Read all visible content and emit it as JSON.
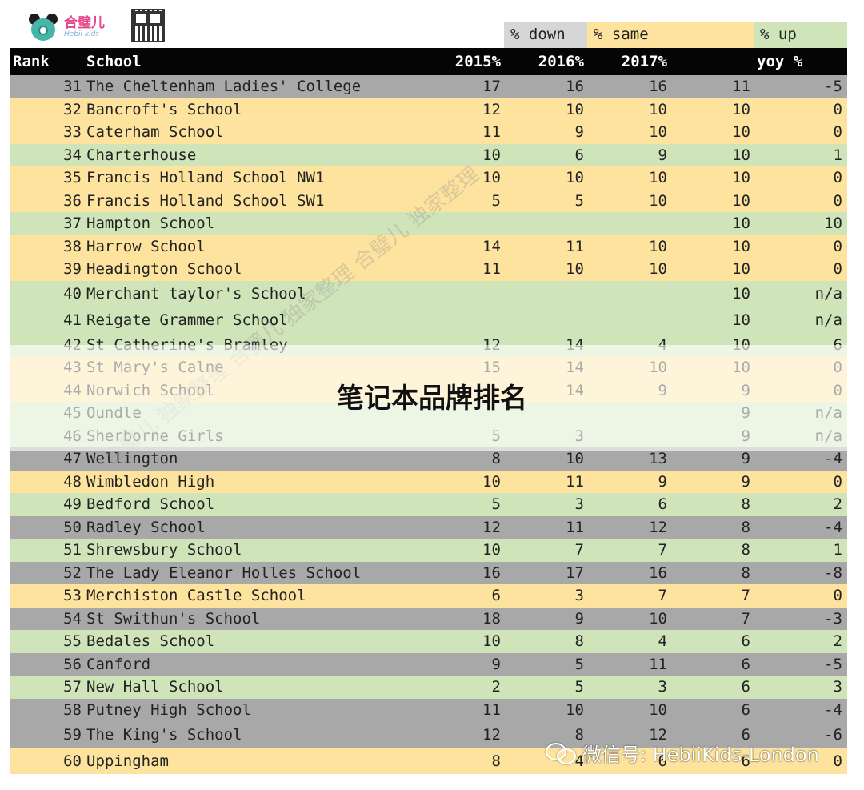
{
  "brand": {
    "cn": "合璧儿",
    "en": "Hebii kids"
  },
  "legend": {
    "down": "% down",
    "same": "% same",
    "up": "% up"
  },
  "header": {
    "rank": "Rank",
    "school": "School",
    "y2015": "2015%",
    "y2016": "2016%",
    "y2017": "2017%",
    "yoy": "yoy %"
  },
  "colors": {
    "down": "#a8a8a8",
    "same": "#fde39d",
    "up": "#cfe4b8",
    "header_bg": "#050505"
  },
  "rows": [
    {
      "rank": "31",
      "school": "The Cheltenham Ladies' College",
      "y2015": "17",
      "y2016": "16",
      "y2017": "16",
      "cur": "11",
      "yoy": "-5",
      "status": "down"
    },
    {
      "rank": "32",
      "school": "Bancroft's School",
      "y2015": "12",
      "y2016": "10",
      "y2017": "10",
      "cur": "10",
      "yoy": "0",
      "status": "same"
    },
    {
      "rank": "33",
      "school": "Caterham School",
      "y2015": "11",
      "y2016": "9",
      "y2017": "10",
      "cur": "10",
      "yoy": "0",
      "status": "same"
    },
    {
      "rank": "34",
      "school": "Charterhouse",
      "y2015": "10",
      "y2016": "6",
      "y2017": "9",
      "cur": "10",
      "yoy": "1",
      "status": "up"
    },
    {
      "rank": "35",
      "school": "Francis Holland School NW1",
      "y2015": "10",
      "y2016": "10",
      "y2017": "10",
      "cur": "10",
      "yoy": "0",
      "status": "same"
    },
    {
      "rank": "36",
      "school": "Francis Holland School SW1",
      "y2015": "5",
      "y2016": "5",
      "y2017": "10",
      "cur": "10",
      "yoy": "0",
      "status": "same"
    },
    {
      "rank": "37",
      "school": "Hampton School",
      "y2015": "",
      "y2016": "",
      "y2017": "",
      "cur": "10",
      "yoy": "10",
      "status": "up"
    },
    {
      "rank": "38",
      "school": "Harrow School",
      "y2015": "14",
      "y2016": "11",
      "y2017": "10",
      "cur": "10",
      "yoy": "0",
      "status": "same"
    },
    {
      "rank": "39",
      "school": "Headington School",
      "y2015": "11",
      "y2016": "10",
      "y2017": "10",
      "cur": "10",
      "yoy": "0",
      "status": "same"
    },
    {
      "rank": "40",
      "school": "Merchant taylor's School",
      "y2015": "",
      "y2016": "",
      "y2017": "",
      "cur": "10",
      "yoy": "n/a",
      "status": "up"
    },
    {
      "rank": "41",
      "school": "Reigate Grammer School",
      "y2015": "",
      "y2016": "",
      "y2017": "",
      "cur": "10",
      "yoy": "n/a",
      "status": "up"
    },
    {
      "rank": "42",
      "school": "St Catherine's Bramley",
      "y2015": "12",
      "y2016": "14",
      "y2017": "4",
      "cur": "10",
      "yoy": "6",
      "status": "up"
    },
    {
      "rank": "43",
      "school": "St Mary's Calne",
      "y2015": "15",
      "y2016": "14",
      "y2017": "10",
      "cur": "10",
      "yoy": "0",
      "status": "same"
    },
    {
      "rank": "44",
      "school": "Norwich School",
      "y2015": "",
      "y2016": "14",
      "y2017": "9",
      "cur": "9",
      "yoy": "0",
      "status": "same"
    },
    {
      "rank": "45",
      "school": "Oundle",
      "y2015": "",
      "y2016": "",
      "y2017": "",
      "cur": "9",
      "yoy": "n/a",
      "status": "up"
    },
    {
      "rank": "46",
      "school": "Sherborne Girls",
      "y2015": "5",
      "y2016": "3",
      "y2017": "",
      "cur": "9",
      "yoy": "n/a",
      "status": "up"
    },
    {
      "rank": "47",
      "school": "Wellington",
      "y2015": "8",
      "y2016": "10",
      "y2017": "13",
      "cur": "9",
      "yoy": "-4",
      "status": "down"
    },
    {
      "rank": "48",
      "school": "Wimbledon High",
      "y2015": "10",
      "y2016": "11",
      "y2017": "9",
      "cur": "9",
      "yoy": "0",
      "status": "same"
    },
    {
      "rank": "49",
      "school": "Bedford School",
      "y2015": "5",
      "y2016": "3",
      "y2017": "6",
      "cur": "8",
      "yoy": "2",
      "status": "up"
    },
    {
      "rank": "50",
      "school": "Radley School",
      "y2015": "12",
      "y2016": "11",
      "y2017": "12",
      "cur": "8",
      "yoy": "-4",
      "status": "down"
    },
    {
      "rank": "51",
      "school": "Shrewsbury School",
      "y2015": "10",
      "y2016": "7",
      "y2017": "7",
      "cur": "8",
      "yoy": "1",
      "status": "up"
    },
    {
      "rank": "52",
      "school": "The Lady Eleanor Holles School",
      "y2015": "16",
      "y2016": "17",
      "y2017": "16",
      "cur": "8",
      "yoy": "-8",
      "status": "down"
    },
    {
      "rank": "53",
      "school": "Merchiston Castle School",
      "y2015": "6",
      "y2016": "3",
      "y2017": "7",
      "cur": "7",
      "yoy": "0",
      "status": "same"
    },
    {
      "rank": "54",
      "school": "St Swithun's School",
      "y2015": "18",
      "y2016": "9",
      "y2017": "10",
      "cur": "7",
      "yoy": "-3",
      "status": "down"
    },
    {
      "rank": "55",
      "school": "Bedales School",
      "y2015": "10",
      "y2016": "8",
      "y2017": "4",
      "cur": "6",
      "yoy": "2",
      "status": "up"
    },
    {
      "rank": "56",
      "school": "Canford",
      "y2015": "9",
      "y2016": "5",
      "y2017": "11",
      "cur": "6",
      "yoy": "-5",
      "status": "down"
    },
    {
      "rank": "57",
      "school": "New Hall School",
      "y2015": "2",
      "y2016": "5",
      "y2017": "3",
      "cur": "6",
      "yoy": "3",
      "status": "up"
    },
    {
      "rank": "58",
      "school": "Putney High School",
      "y2015": "11",
      "y2016": "10",
      "y2017": "10",
      "cur": "6",
      "yoy": "-4",
      "status": "down"
    },
    {
      "rank": "59",
      "school": "The King's School",
      "y2015": "12",
      "y2016": "8",
      "y2017": "12",
      "cur": "6",
      "yoy": "-6",
      "status": "down"
    },
    {
      "rank": "60",
      "school": "Uppingham",
      "y2015": "8",
      "y2016": "4",
      "y2017": "6",
      "cur": "6",
      "yoy": "0",
      "status": "same"
    }
  ],
  "overlay_title": "笔记本品牌排名",
  "watermark": {
    "diagonal": "合璧儿 独家整理 合璧儿 独家整理 合璧儿 独家整理",
    "wechat": "微信号: HebiiKids-London"
  }
}
